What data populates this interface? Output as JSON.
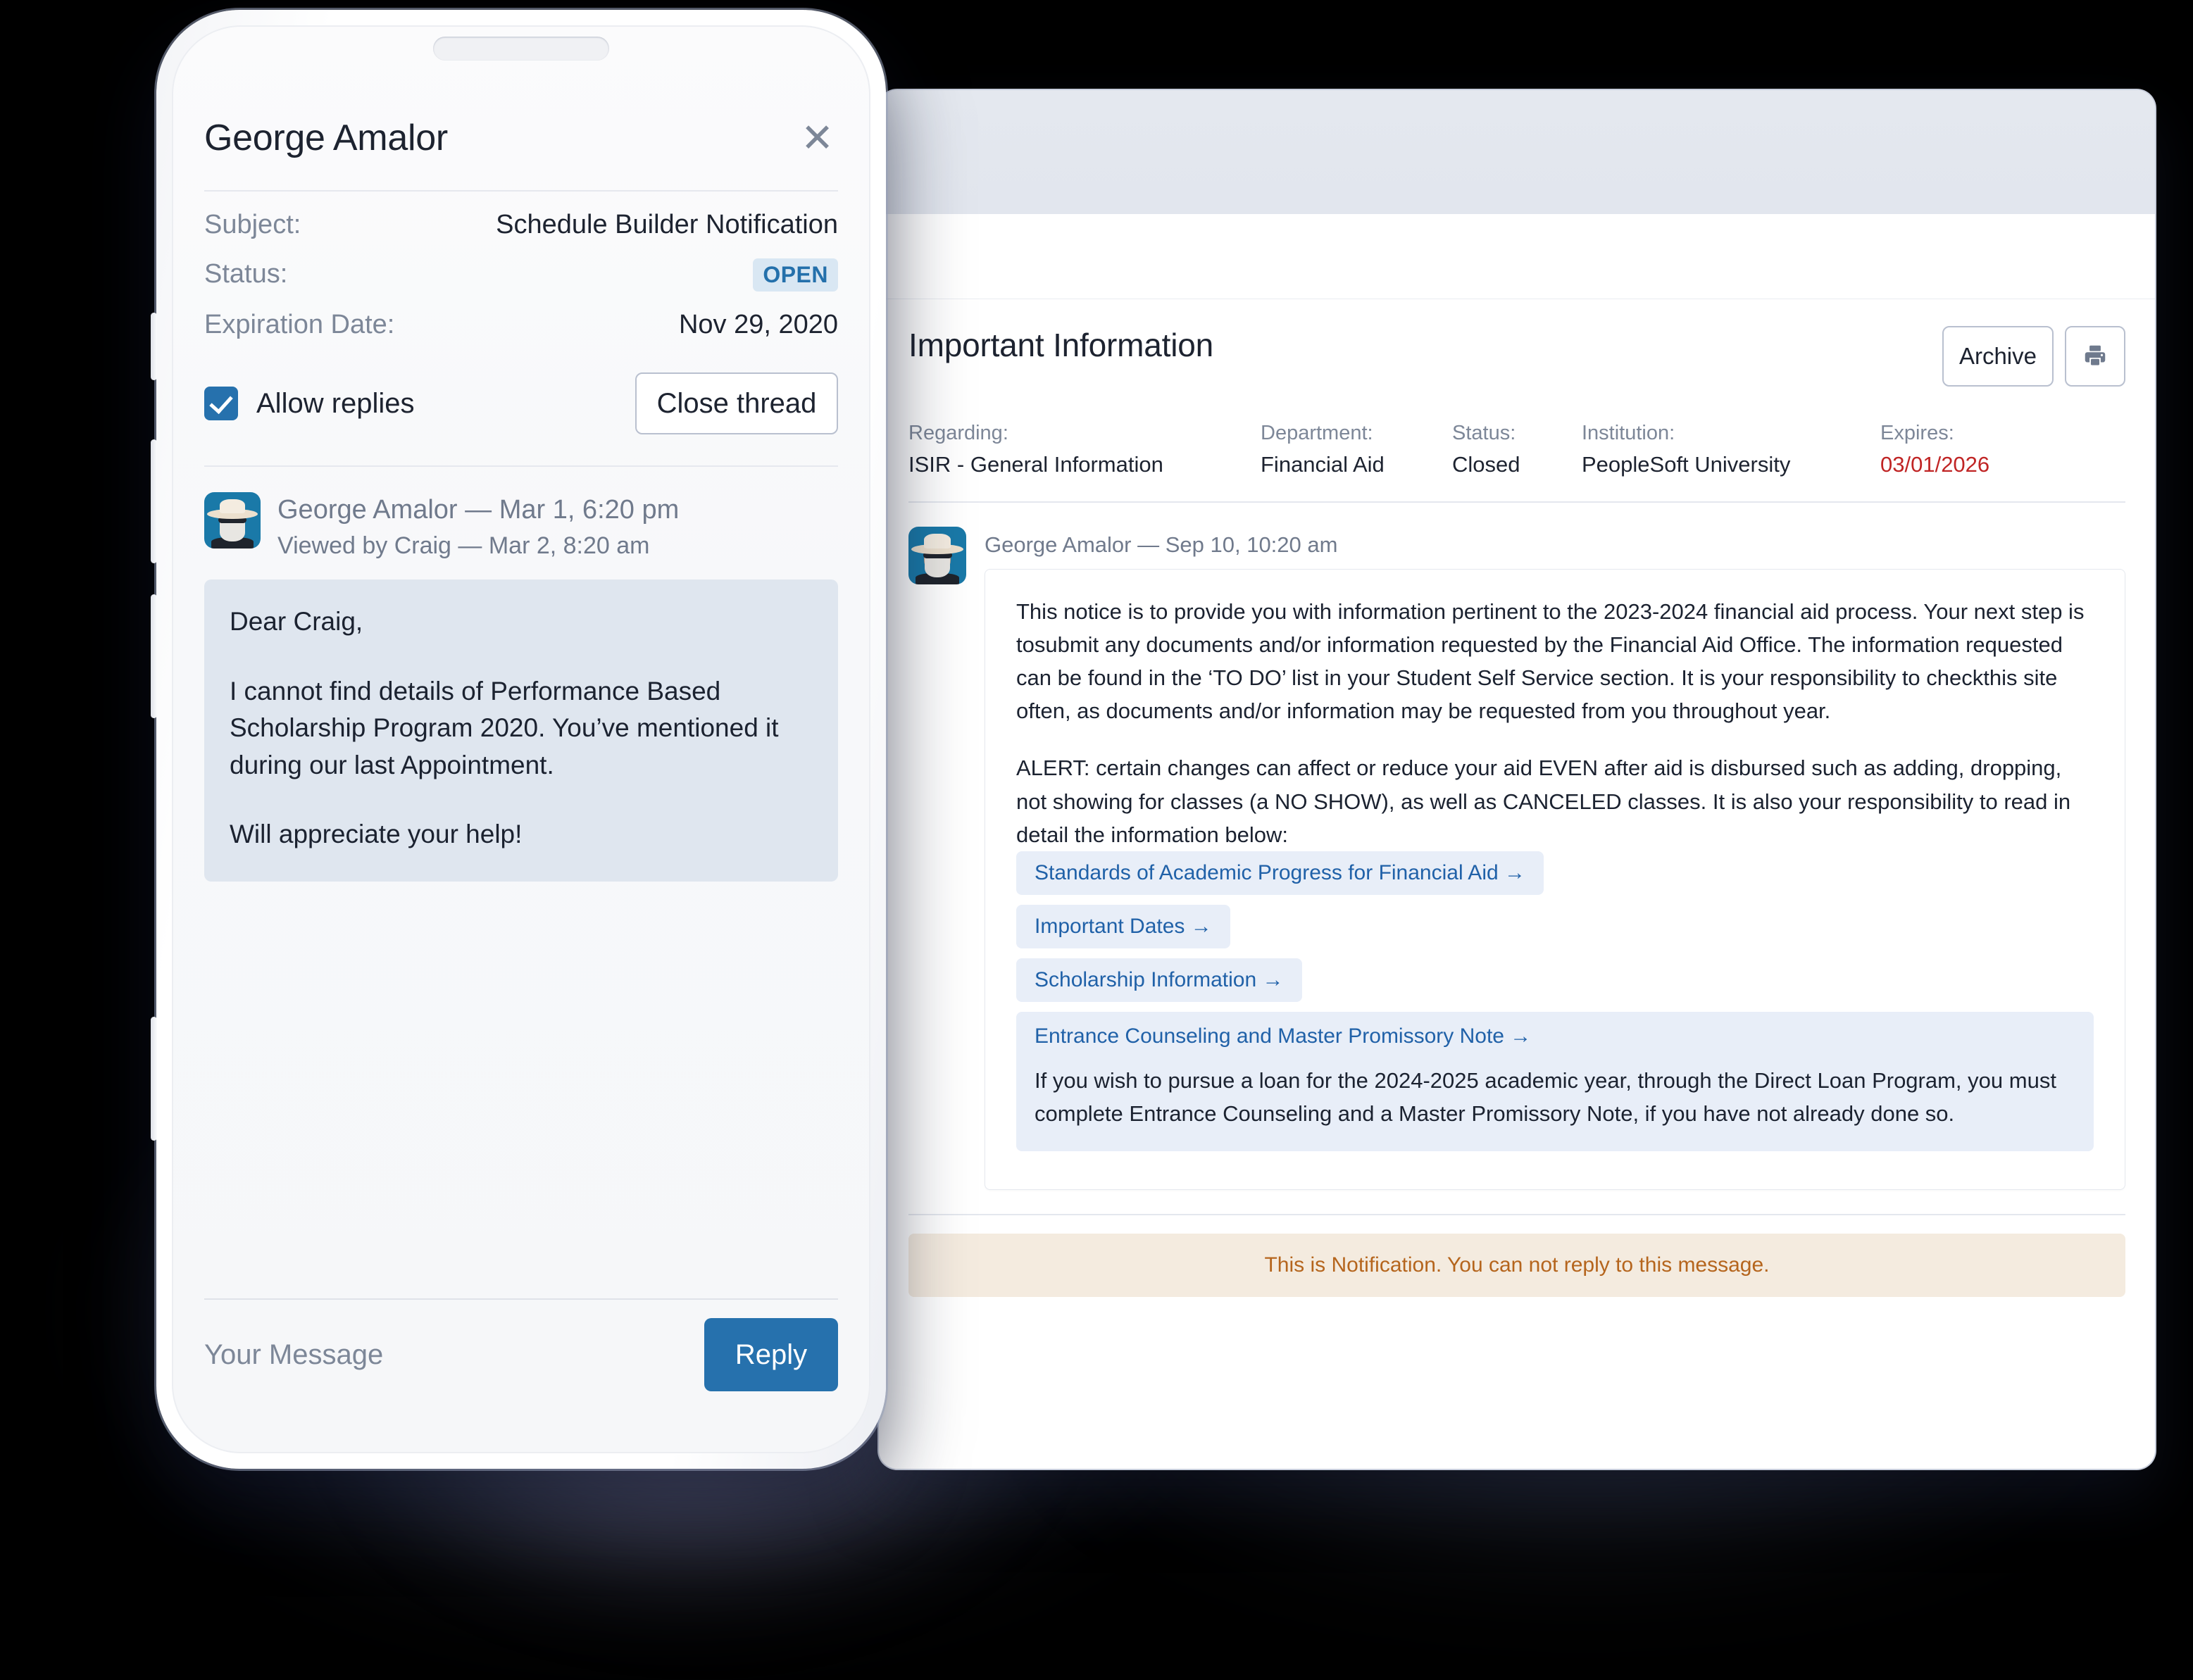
{
  "phone": {
    "header": {
      "title": "George Amalor",
      "close_icon": "close-icon"
    },
    "fields": [
      {
        "label": "Subject:",
        "value": "Schedule Builder Notification",
        "type": "text"
      },
      {
        "label": "Status:",
        "value": "OPEN",
        "type": "badge"
      },
      {
        "label": "Expiration Date:",
        "value": "Nov 29, 2020",
        "type": "text"
      }
    ],
    "allow_replies_label": "Allow replies",
    "allow_replies_checked": true,
    "close_thread_label": "Close thread",
    "message": {
      "author_line": "George Amalor — Mar 1, 6:20 pm",
      "viewed_line": "Viewed by Craig — Mar 2, 8:20 am",
      "paragraphs": [
        "Dear Craig,",
        "I cannot find details of Performance Based Scholarship Program 2020. You’ve mentioned it during our last Appointment.",
        "Will appreciate your help!"
      ]
    },
    "composer": {
      "placeholder": "Your Message",
      "reply_label": "Reply"
    }
  },
  "tablet": {
    "title": "Important Information",
    "actions": {
      "archive_label": "Archive",
      "print_icon": "printer-icon"
    },
    "meta": [
      {
        "label": "Regarding:",
        "value": "ISIR - General Information"
      },
      {
        "label": "Department:",
        "value": "Financial Aid"
      },
      {
        "label": "Status:",
        "value": "Closed"
      },
      {
        "label": "Institution:",
        "value": "PeopleSoft University"
      },
      {
        "label": "Expires:",
        "value": "03/01/2026"
      }
    ],
    "message": {
      "author_line": "George Amalor — Sep 10, 10:20 am",
      "paragraphs": [
        "This notice is to provide you with information pertinent to the 2023-2024 financial aid process. Your next step is tosubmit any documents and/or information requested by the Financial Aid Office. The information requested can be found in the ‘TO DO’ list in your Student Self Service section. It is your responsibility to checkthis site often, as documents and/or information may be requested from you throughout year.",
        "ALERT: certain changes can affect or reduce your aid EVEN after aid is disbursed such as adding, dropping, not showing for classes (a NO SHOW), as well as CANCELED classes. It is also your responsibility to read in detail the information below:"
      ],
      "links": [
        "Standards of Academic Progress for Financial Aid  →",
        "Important Dates  →",
        "Scholarship Information  →"
      ],
      "link_block": {
        "title": "Entrance Counseling and Master Promissory Note  →",
        "paragraph": "If you wish to pursue a loan for the 2024-2025 academic year, through the Direct Loan Program, you must complete Entrance Counseling and a Master Promissory Note, if you have not already done so."
      }
    },
    "notice": "This is Notification. You can not reply to this message."
  },
  "colors": {
    "accent_blue": "#2671ad",
    "link_blue": "#2061a8",
    "badge_bg": "#d9e7f3",
    "expire_red": "#c02525",
    "notice_bg": "#f4ebdf",
    "notice_text": "#b5651d",
    "bubble_bg": "#dfe6ef"
  }
}
